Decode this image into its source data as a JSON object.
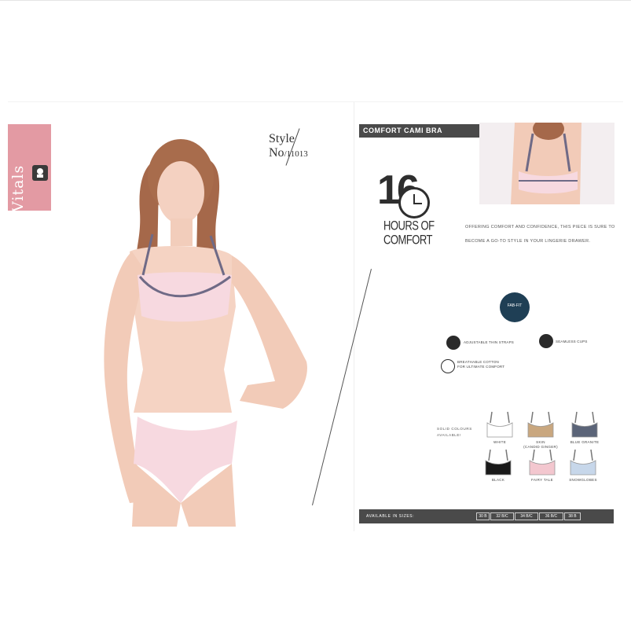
{
  "brand": {
    "name": "Vitals",
    "logo_icon": "vitals-logo-icon",
    "tab_color": "#e39aa3"
  },
  "style": {
    "word": "Style",
    "no": "No",
    "number": "11013"
  },
  "product": {
    "title": "COMFORT CAMI BRA"
  },
  "hours": {
    "number": "16",
    "line1": "HOURS OF",
    "line2": "COMFORT"
  },
  "description": {
    "line1": "OFFERING COMFORT AND CONFIDENCE, THIS PIECE IS SURE TO",
    "line2": "BECOME A GO-TO STYLE IN YOUR LINGERIE DRAWER."
  },
  "badge": {
    "label": "FAB-FIT"
  },
  "features": [
    {
      "icon": "strap-icon",
      "label": "ADJUSTABLE THIN STRAPS"
    },
    {
      "icon": "cup-icon",
      "label": "SEAMLESS CUPS"
    },
    {
      "icon": "cotton-icon",
      "label": "BREATHABLE COTTON",
      "sub": "FOR ULTIMATE COMFORT"
    }
  ],
  "colours": {
    "label_line1": "SOLID COLOURS",
    "label_line2": "AVAILABLE!",
    "swatches": [
      {
        "name": "WHITE",
        "color": "#ffffff"
      },
      {
        "name": "SKIN",
        "sub": "(CANDID GINGER)",
        "color": "#c9a77f"
      },
      {
        "name": "BLUE GRANITE",
        "color": "#5b6478"
      },
      {
        "name": "BLACK",
        "color": "#1a1a1a"
      },
      {
        "name": "FAIRY TALE",
        "color": "#f3c7cf"
      },
      {
        "name": "SNOWGLOBES",
        "color": "#c7d7ea"
      }
    ]
  },
  "sizes": {
    "label": "AVAILABLE IN SIZES:",
    "items": [
      "30 B",
      "32 B/C",
      "34 B/C",
      "36 B/C",
      "38 B"
    ]
  },
  "colors": {
    "dark_bar": "#4a4a4a",
    "badge": "#1f3f55",
    "pink": "#f6d6dd"
  }
}
